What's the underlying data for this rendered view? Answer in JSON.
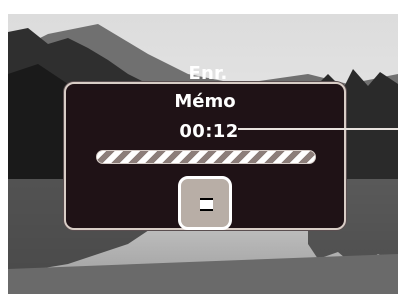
{
  "recorder": {
    "title_line1": "Enr.",
    "title_line2": "Mémo",
    "elapsed": "00:12",
    "progress": 1.0,
    "stop_icon": "stop-icon"
  },
  "colors": {
    "dialog_bg": "#1f1216",
    "dialog_border": "#d8cdc6",
    "stripe_light": "#ffffff",
    "stripe_dark": "#8c7e7a",
    "button_bg": "#b8aea6"
  }
}
